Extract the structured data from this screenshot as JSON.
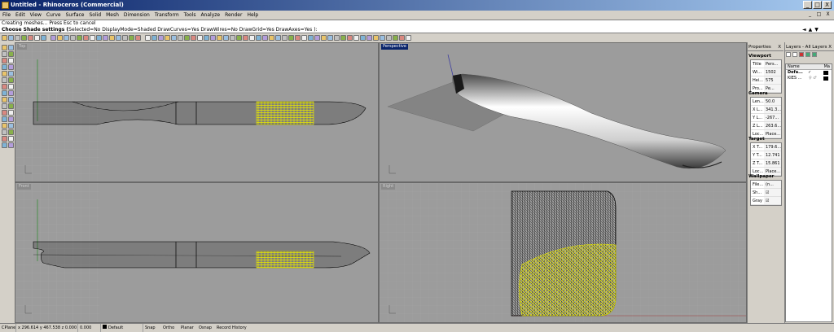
{
  "window": {
    "title": "Untitled - Rhinoceros (Commercial)",
    "min": "_",
    "max": "□",
    "close": "X"
  },
  "menubar": {
    "items": [
      "File",
      "Edit",
      "View",
      "Curve",
      "Surface",
      "Solid",
      "Mesh",
      "Dimension",
      "Transform",
      "Tools",
      "Analyze",
      "Render",
      "Help"
    ]
  },
  "command": {
    "history": "Creating meshes... Press Esc to cancel",
    "prompt": "Choose Shade settings (",
    "options": "Selected=No  DisplayMode=Shaded  DrawCurves=Yes  DrawWires=No  DrawGrid=Yes  DrawAxes=Yes",
    "close": " ):"
  },
  "viewports": {
    "top": {
      "label": "Top"
    },
    "perspective": {
      "label": "Perspective"
    },
    "front": {
      "label": "Front"
    },
    "right": {
      "label": "Right"
    }
  },
  "properties": {
    "header": "Properties",
    "close": "X",
    "viewport_section": "Viewport",
    "viewport_rows": [
      {
        "key": "Title",
        "value": "Pers..."
      },
      {
        "key": "Wi...",
        "value": "1502"
      },
      {
        "key": "Hei...",
        "value": "575"
      },
      {
        "key": "Pro...",
        "value": "Pe..."
      }
    ],
    "camera_section": "Camera",
    "camera_rows": [
      {
        "key": "Len...",
        "value": "50.0"
      },
      {
        "key": "X L...",
        "value": "341.3..."
      },
      {
        "key": "Y L...",
        "value": "-267..."
      },
      {
        "key": "Z L...",
        "value": "263.6..."
      },
      {
        "key": "Loc...",
        "value": "Place..."
      }
    ],
    "target_section": "Target",
    "target_rows": [
      {
        "key": "X T...",
        "value": "179.6..."
      },
      {
        "key": "Y T...",
        "value": "12.741"
      },
      {
        "key": "Z T...",
        "value": "15.861"
      },
      {
        "key": "Loc...",
        "value": "Place..."
      }
    ],
    "wallpaper_section": "Wallpaper",
    "wallpaper_rows": [
      {
        "key": "File...",
        "value": "(n..."
      },
      {
        "key": "Sh...",
        "value": "☑"
      },
      {
        "key": "Gray",
        "value": "☑"
      }
    ]
  },
  "layers": {
    "header": "Layers - All Layers",
    "close": "X",
    "columns": [
      "Name",
      "Ma"
    ],
    "rows": [
      {
        "name": "Defa...",
        "flags": "✓"
      },
      {
        "name": "KIES ...",
        "flags": "♀ ♂"
      }
    ]
  },
  "statusbar": {
    "cplane": "CPlane",
    "coords": "x 296.614  y 467.538  z 0.000",
    "extra": "0.000",
    "layer": "Default",
    "snap": "Snap",
    "ortho": "Ortho",
    "planar": "Planar",
    "osnap": "Osnap",
    "record": "Record History"
  },
  "colors": {
    "titlebar": "#0a246a",
    "viewport_bg": "#9c9c9c",
    "highlight_mesh": "#e8e800",
    "wire": "#000000"
  }
}
